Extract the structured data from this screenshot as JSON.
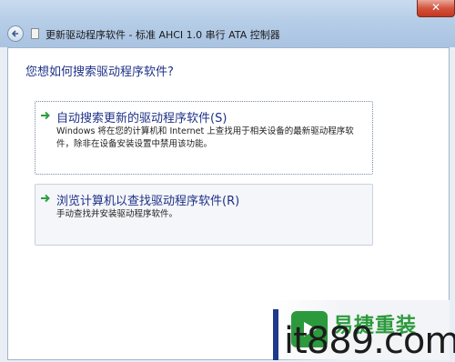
{
  "window": {
    "title": "更新驱动程序软件 - 标准 AHCI 1.0 串行 ATA 控制器",
    "close_glyph": "✕"
  },
  "main": {
    "question": "您想如何搜索驱动程序软件?",
    "options": [
      {
        "title": "自动搜索更新的驱动程序软件(S)",
        "description": "Windows 将在您的计算机和 Internet 上查找用于相关设备的最新驱动程序软件，除非在设备安装设置中禁用该功能。"
      },
      {
        "title": "浏览计算机以查找驱动程序软件(R)",
        "description": "手动查找并安装驱动程序软件。"
      }
    ]
  },
  "watermark": {
    "url": "it889.com",
    "brand": "易捷重装"
  },
  "colors": {
    "link_blue": "#1e3287",
    "arrow_green": "#2f9e41",
    "close_red": "#c3371f"
  },
  "icons": [
    "back-arrow-icon",
    "driver-icon",
    "green-arrow-icon"
  ]
}
